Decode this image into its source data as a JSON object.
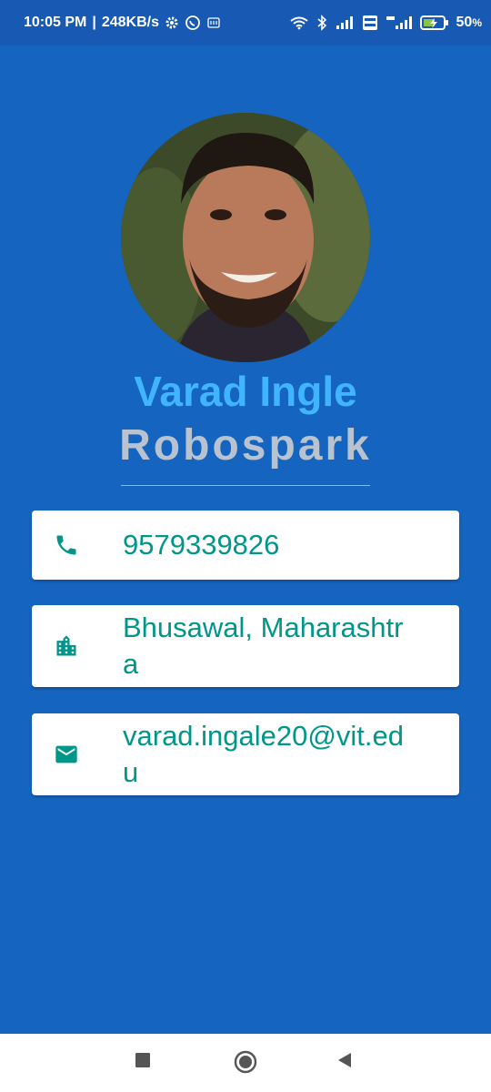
{
  "status_bar": {
    "time": "10:05 PM",
    "speed": "248KB/s",
    "battery": "50",
    "battery_unit": "%",
    "icons": [
      "settings-icon",
      "whatsapp-icon",
      "message-icon",
      "wifi-icon",
      "bluetooth-icon",
      "signal-icon",
      "volte-icon",
      "signal-4g-icon",
      "battery-charging-icon"
    ]
  },
  "profile": {
    "name": "Varad Ingle",
    "organization": "Robospark"
  },
  "cards": {
    "phone": {
      "icon": "phone-icon",
      "text": "9579339826"
    },
    "location": {
      "icon": "city-icon",
      "text": "Bhusawal, Maharashtra"
    },
    "email": {
      "icon": "email-icon",
      "text": "varad.ingale20@vit.edu"
    }
  },
  "nav_bar": {
    "icons": [
      "recents-icon",
      "home-icon",
      "back-icon"
    ]
  },
  "colors": {
    "background": "#1565C0",
    "name": "#40B4FF",
    "organization": "#B9C3D0",
    "card_text": "#009688",
    "card_bg": "#FFFFFF"
  }
}
